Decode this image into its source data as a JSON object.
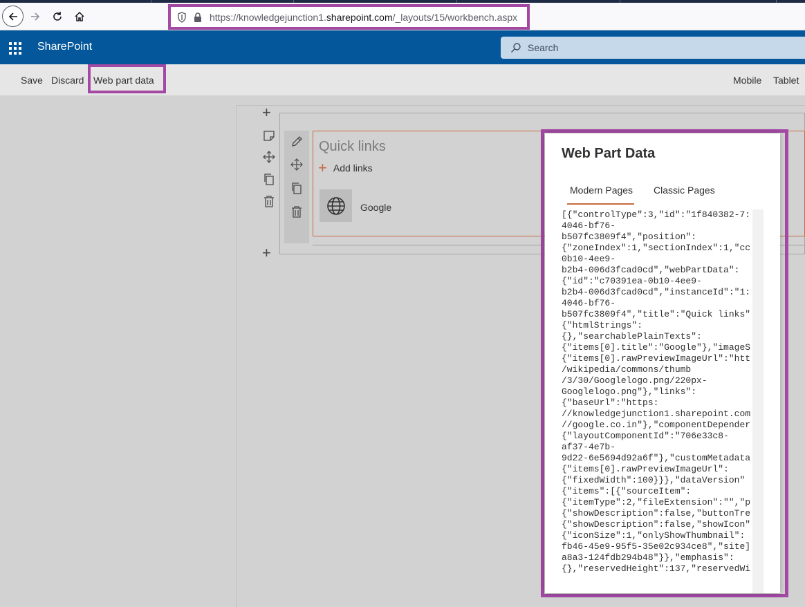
{
  "browser": {
    "url_prefix": "https://knowledgejunction1.",
    "url_domain": "sharepoint.com",
    "url_path": "/_layouts/15/workbench.aspx"
  },
  "suitebar": {
    "brand": "SharePoint",
    "search_placeholder": "Search"
  },
  "commandbar": {
    "save": "Save",
    "discard": "Discard",
    "web_part_data": "Web part data",
    "mobile": "Mobile",
    "tablet": "Tablet"
  },
  "webpart": {
    "title": "Quick links",
    "add_links": "Add links",
    "links": [
      {
        "label": "Google"
      }
    ]
  },
  "panel": {
    "title": "Web Part Data",
    "tabs": [
      {
        "label": "Modern Pages"
      },
      {
        "label": "Classic Pages"
      }
    ],
    "code_lines": [
      "[{\"controlType\":3,\"id\":\"1f840382-7:",
      "4046-bf76-",
      "b507fc3809f4\",\"position\":",
      "{\"zoneIndex\":1,\"sectionIndex\":1,\"cc",
      "0b10-4ee9-",
      "b2b4-006d3fcad0cd\",\"webPartData\":",
      "{\"id\":\"c70391ea-0b10-4ee9-",
      "b2b4-006d3fcad0cd\",\"instanceId\":\"1:",
      "4046-bf76-",
      "b507fc3809f4\",\"title\":\"Quick links\"",
      "{\"htmlStrings\":",
      "{},\"searchablePlainTexts\":",
      "{\"items[0].title\":\"Google\"},\"imageS",
      "{\"items[0].rawPreviewImageUrl\":\"htt",
      "/wikipedia/commons/thumb",
      "/3/30/Googlelogo.png/220px-",
      "Googlelogo.png\"},\"links\":",
      "{\"baseUrl\":\"https:",
      "//knowledgejunction1.sharepoint.com",
      "//google.co.in\"},\"componentDepender",
      "{\"layoutComponentId\":\"706e33c8-",
      "af37-4e7b-",
      "9d22-6e5694d92a6f\"},\"customMetadata",
      "{\"items[0].rawPreviewImageUrl\":",
      "{\"fixedWidth\":100}}},\"dataVersion\"",
      "{\"items\":[{\"sourceItem\":",
      "{\"itemType\":2,\"fileExtension\":\"\",\"p",
      "{\"showDescription\":false,\"buttonTre",
      "{\"showDescription\":false,\"showIcon\"",
      "{\"iconSize\":1,\"onlyShowThumbnail\":",
      "fb46-45e9-95f5-35e02c934ce8\",\"site]",
      "a8a3-124fdb294b48\"}},\"emphasis\":",
      "{},\"reservedHeight\":137,\"reservedWi"
    ]
  },
  "colors": {
    "suitebar": "#03579a",
    "highlight": "#a349a4",
    "accent": "#c86b40"
  }
}
